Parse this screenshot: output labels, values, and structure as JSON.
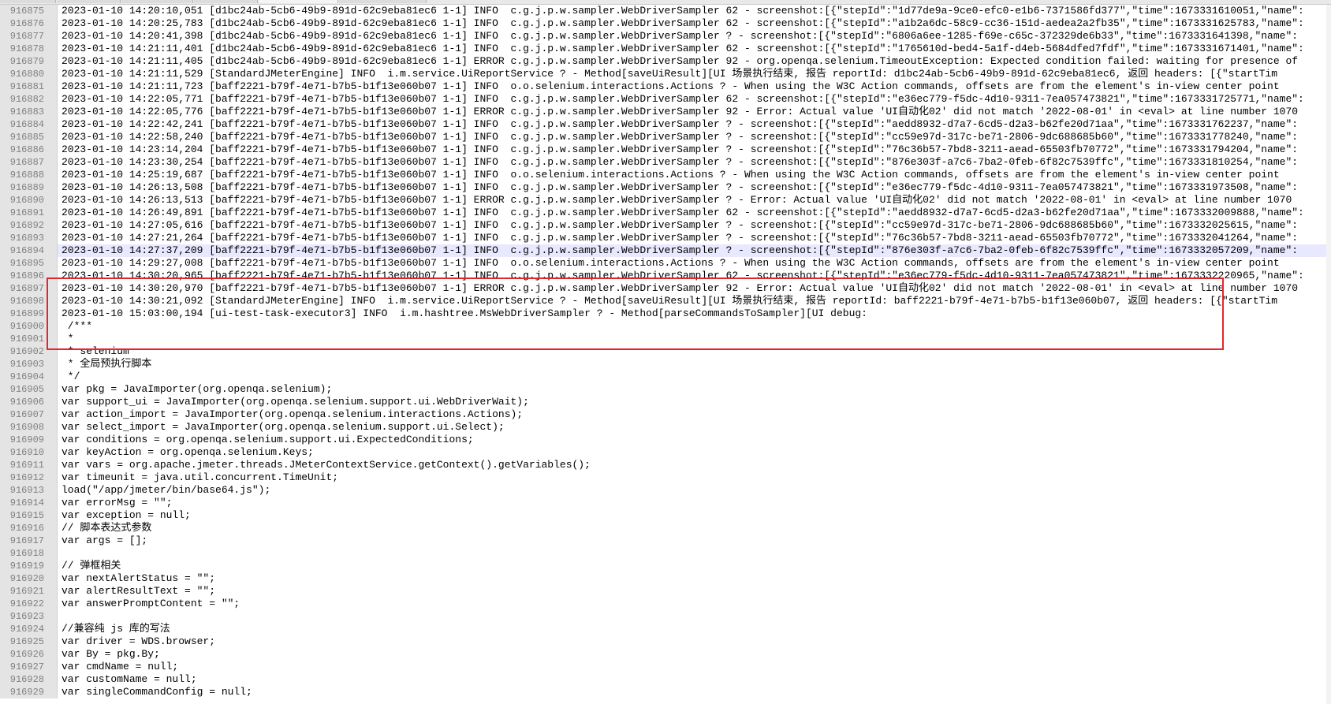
{
  "colors": {
    "background": "#ffffff",
    "gutter_bg": "#e4e4e4",
    "gutter_text": "#808080",
    "code_text": "#000000",
    "current_line_bg": "#e8e8ff",
    "annotation_border": "#e3262d"
  },
  "editor": {
    "highlighted_line": "916894",
    "lines": [
      {
        "num": "916875",
        "text": "2023-01-10 14:20:10,051 [d1bc24ab-5cb6-49b9-891d-62c9eba81ec6 1-1] INFO  c.g.j.p.w.sampler.WebDriverSampler 62 - screenshot:[{\"stepId\":\"1d77de9a-9ce0-efc0-e1b6-7371586fd377\",\"time\":1673331610051,\"name\":"
      },
      {
        "num": "916876",
        "text": "2023-01-10 14:20:25,783 [d1bc24ab-5cb6-49b9-891d-62c9eba81ec6 1-1] INFO  c.g.j.p.w.sampler.WebDriverSampler 62 - screenshot:[{\"stepId\":\"a1b2a6dc-58c9-cc36-151d-aedea2a2fb35\",\"time\":1673331625783,\"name\":"
      },
      {
        "num": "916877",
        "text": "2023-01-10 14:20:41,398 [d1bc24ab-5cb6-49b9-891d-62c9eba81ec6 1-1] INFO  c.g.j.p.w.sampler.WebDriverSampler ? - screenshot:[{\"stepId\":\"6806a6ee-1285-f69e-c65c-372329de6b33\",\"time\":1673331641398,\"name\":"
      },
      {
        "num": "916878",
        "text": "2023-01-10 14:21:11,401 [d1bc24ab-5cb6-49b9-891d-62c9eba81ec6 1-1] INFO  c.g.j.p.w.sampler.WebDriverSampler 62 - screenshot:[{\"stepId\":\"1765610d-bed4-5a1f-d4eb-5684dfed7fdf\",\"time\":1673331671401,\"name\":"
      },
      {
        "num": "916879",
        "text": "2023-01-10 14:21:11,405 [d1bc24ab-5cb6-49b9-891d-62c9eba81ec6 1-1] ERROR c.g.j.p.w.sampler.WebDriverSampler 92 - org.openqa.selenium.TimeoutException: Expected condition failed: waiting for presence of"
      },
      {
        "num": "916880",
        "text": "2023-01-10 14:21:11,529 [StandardJMeterEngine] INFO  i.m.service.UiReportService ? - Method[saveUiResult][UI 场景执行结束, 报告 reportId: d1bc24ab-5cb6-49b9-891d-62c9eba81ec6, 返回 headers: [{\"startTim"
      },
      {
        "num": "916881",
        "text": "2023-01-10 14:21:11,723 [baff2221-b79f-4e71-b7b5-b1f13e060b07 1-1] INFO  o.o.selenium.interactions.Actions ? - When using the W3C Action commands, offsets are from the element's in-view center point"
      },
      {
        "num": "916882",
        "text": "2023-01-10 14:22:05,771 [baff2221-b79f-4e71-b7b5-b1f13e060b07 1-1] INFO  c.g.j.p.w.sampler.WebDriverSampler 62 - screenshot:[{\"stepId\":\"e36ec779-f5dc-4d10-9311-7ea057473821\",\"time\":1673331725771,\"name\":"
      },
      {
        "num": "916883",
        "text": "2023-01-10 14:22:05,776 [baff2221-b79f-4e71-b7b5-b1f13e060b07 1-1] ERROR c.g.j.p.w.sampler.WebDriverSampler 92 - Error: Actual value 'UI自动化02' did not match '2022-08-01' in <eval> at line number 1070"
      },
      {
        "num": "916884",
        "text": "2023-01-10 14:22:42,241 [baff2221-b79f-4e71-b7b5-b1f13e060b07 1-1] INFO  c.g.j.p.w.sampler.WebDriverSampler ? - screenshot:[{\"stepId\":\"aedd8932-d7a7-6cd5-d2a3-b62fe20d71aa\",\"time\":1673331762237,\"name\":"
      },
      {
        "num": "916885",
        "text": "2023-01-10 14:22:58,240 [baff2221-b79f-4e71-b7b5-b1f13e060b07 1-1] INFO  c.g.j.p.w.sampler.WebDriverSampler ? - screenshot:[{\"stepId\":\"cc59e97d-317c-be71-2806-9dc688685b60\",\"time\":1673331778240,\"name\":"
      },
      {
        "num": "916886",
        "text": "2023-01-10 14:23:14,204 [baff2221-b79f-4e71-b7b5-b1f13e060b07 1-1] INFO  c.g.j.p.w.sampler.WebDriverSampler ? - screenshot:[{\"stepId\":\"76c36b57-7bd8-3211-aead-65503fb70772\",\"time\":1673331794204,\"name\":"
      },
      {
        "num": "916887",
        "text": "2023-01-10 14:23:30,254 [baff2221-b79f-4e71-b7b5-b1f13e060b07 1-1] INFO  c.g.j.p.w.sampler.WebDriverSampler ? - screenshot:[{\"stepId\":\"876e303f-a7c6-7ba2-0feb-6f82c7539ffc\",\"time\":1673331810254,\"name\":"
      },
      {
        "num": "916888",
        "text": "2023-01-10 14:25:19,687 [baff2221-b79f-4e71-b7b5-b1f13e060b07 1-1] INFO  o.o.selenium.interactions.Actions ? - When using the W3C Action commands, offsets are from the element's in-view center point"
      },
      {
        "num": "916889",
        "text": "2023-01-10 14:26:13,508 [baff2221-b79f-4e71-b7b5-b1f13e060b07 1-1] INFO  c.g.j.p.w.sampler.WebDriverSampler ? - screenshot:[{\"stepId\":\"e36ec779-f5dc-4d10-9311-7ea057473821\",\"time\":1673331973508,\"name\":"
      },
      {
        "num": "916890",
        "text": "2023-01-10 14:26:13,513 [baff2221-b79f-4e71-b7b5-b1f13e060b07 1-1] ERROR c.g.j.p.w.sampler.WebDriverSampler ? - Error: Actual value 'UI自动化02' did not match '2022-08-01' in <eval> at line number 1070"
      },
      {
        "num": "916891",
        "text": "2023-01-10 14:26:49,891 [baff2221-b79f-4e71-b7b5-b1f13e060b07 1-1] INFO  c.g.j.p.w.sampler.WebDriverSampler 62 - screenshot:[{\"stepId\":\"aedd8932-d7a7-6cd5-d2a3-b62fe20d71aa\",\"time\":1673332009888,\"name\":"
      },
      {
        "num": "916892",
        "text": "2023-01-10 14:27:05,616 [baff2221-b79f-4e71-b7b5-b1f13e060b07 1-1] INFO  c.g.j.p.w.sampler.WebDriverSampler ? - screenshot:[{\"stepId\":\"cc59e97d-317c-be71-2806-9dc688685b60\",\"time\":1673332025615,\"name\":"
      },
      {
        "num": "916893",
        "text": "2023-01-10 14:27:21,264 [baff2221-b79f-4e71-b7b5-b1f13e060b07 1-1] INFO  c.g.j.p.w.sampler.WebDriverSampler ? - screenshot:[{\"stepId\":\"76c36b57-7bd8-3211-aead-65503fb70772\",\"time\":1673332041264,\"name\":"
      },
      {
        "num": "916894",
        "text": "2023-01-10 14:27:37,209 [baff2221-b79f-4e71-b7b5-b1f13e060b07 1-1] INFO  c.g.j.p.w.sampler.WebDriverSampler ? - screenshot:[{\"stepId\":\"876e303f-a7c6-7ba2-0feb-6f82c7539ffc\",\"time\":1673332057209,\"name\":"
      },
      {
        "num": "916895",
        "text": "2023-01-10 14:29:27,008 [baff2221-b79f-4e71-b7b5-b1f13e060b07 1-1] INFO  o.o.selenium.interactions.Actions ? - When using the W3C Action commands, offsets are from the element's in-view center point"
      },
      {
        "num": "916896",
        "text": "2023-01-10 14:30:20,965 [baff2221-b79f-4e71-b7b5-b1f13e060b07 1-1] INFO  c.g.j.p.w.sampler.WebDriverSampler 62 - screenshot:[{\"stepId\":\"e36ec779-f5dc-4d10-9311-7ea057473821\",\"time\":1673332220965,\"name\":"
      },
      {
        "num": "916897",
        "text": "2023-01-10 14:30:20,970 [baff2221-b79f-4e71-b7b5-b1f13e060b07 1-1] ERROR c.g.j.p.w.sampler.WebDriverSampler 92 - Error: Actual value 'UI自动化02' did not match '2022-08-01' in <eval> at line number 1070"
      },
      {
        "num": "916898",
        "text": "2023-01-10 14:30:21,092 [StandardJMeterEngine] INFO  i.m.service.UiReportService ? - Method[saveUiResult][UI 场景执行结束, 报告 reportId: baff2221-b79f-4e71-b7b5-b1f13e060b07, 返回 headers: [{\"startTim"
      },
      {
        "num": "916899",
        "text": "2023-01-10 15:03:00,194 [ui-test-task-executor3] INFO  i.m.hashtree.MsWebDriverSampler ? - Method[parseCommandsToSampler][UI debug:"
      },
      {
        "num": "916900",
        "text": " /***"
      },
      {
        "num": "916901",
        "text": " *"
      },
      {
        "num": "916902",
        "text": " * selenium"
      },
      {
        "num": "916903",
        "text": " * 全局预执行脚本"
      },
      {
        "num": "916904",
        "text": " */"
      },
      {
        "num": "916905",
        "text": "var pkg = JavaImporter(org.openqa.selenium);"
      },
      {
        "num": "916906",
        "text": "var support_ui = JavaImporter(org.openqa.selenium.support.ui.WebDriverWait);"
      },
      {
        "num": "916907",
        "text": "var action_import = JavaImporter(org.openqa.selenium.interactions.Actions);"
      },
      {
        "num": "916908",
        "text": "var select_import = JavaImporter(org.openqa.selenium.support.ui.Select);"
      },
      {
        "num": "916909",
        "text": "var conditions = org.openqa.selenium.support.ui.ExpectedConditions;"
      },
      {
        "num": "916910",
        "text": "var keyAction = org.openqa.selenium.Keys;"
      },
      {
        "num": "916911",
        "text": "var vars = org.apache.jmeter.threads.JMeterContextService.getContext().getVariables();"
      },
      {
        "num": "916912",
        "text": "var timeunit = java.util.concurrent.TimeUnit;"
      },
      {
        "num": "916913",
        "text": "load(\"/app/jmeter/bin/base64.js\");"
      },
      {
        "num": "916914",
        "text": "var errorMsg = \"\";"
      },
      {
        "num": "916915",
        "text": "var exception = null;"
      },
      {
        "num": "916916",
        "text": "// 脚本表达式参数"
      },
      {
        "num": "916917",
        "text": "var args = [];"
      },
      {
        "num": "916918",
        "text": ""
      },
      {
        "num": "916919",
        "text": "// 弹框相关"
      },
      {
        "num": "916920",
        "text": "var nextAlertStatus = \"\";"
      },
      {
        "num": "916921",
        "text": "var alertResultText = \"\";"
      },
      {
        "num": "916922",
        "text": "var answerPromptContent = \"\";"
      },
      {
        "num": "916923",
        "text": ""
      },
      {
        "num": "916924",
        "text": "//兼容纯 js 库的写法"
      },
      {
        "num": "916925",
        "text": "var driver = WDS.browser;"
      },
      {
        "num": "916926",
        "text": "var By = pkg.By;"
      },
      {
        "num": "916927",
        "text": "var cmdName = null;"
      },
      {
        "num": "916928",
        "text": "var customName = null;"
      },
      {
        "num": "916929",
        "text": "var singleCommandConfig = null;"
      }
    ]
  }
}
